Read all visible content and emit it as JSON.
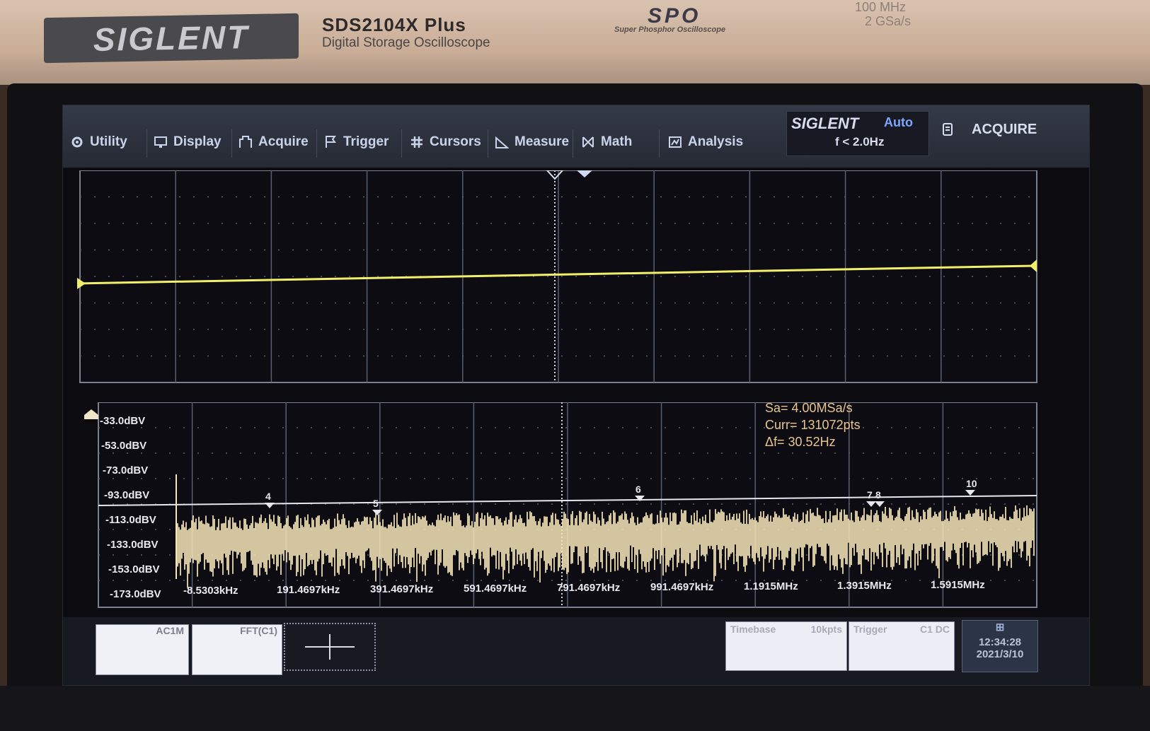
{
  "device": {
    "logo": "SIGLENT",
    "model": "SDS2104X  Plus",
    "model_sub": "Digital Storage Oscilloscope",
    "spo": "SPO",
    "spo_sub": "Super Phosphor Oscilloscope",
    "spec_bandwidth": "100 MHz",
    "spec_samplerate": "2 GSa/s"
  },
  "menu": {
    "items": [
      {
        "label": "Utility",
        "icon": "gear-icon"
      },
      {
        "label": "Display",
        "icon": "monitor-icon"
      },
      {
        "label": "Acquire",
        "icon": "acquire-icon"
      },
      {
        "label": "Trigger",
        "icon": "flag-icon"
      },
      {
        "label": "Cursors",
        "icon": "hash-icon"
      },
      {
        "label": "Measure",
        "icon": "ruler-icon"
      },
      {
        "label": "Math",
        "icon": "math-icon"
      },
      {
        "label": "Analysis",
        "icon": "analysis-icon"
      }
    ],
    "brand": "SIGLENT",
    "trigger_mode": "Auto",
    "trigger_freq": "f < 2.0Hz",
    "acquire_label": "ACQUIRE"
  },
  "fft": {
    "info_sa": "Sa=  4.00MSa/s",
    "info_curr": "Curr= 131072pts",
    "info_df": "Δf=  30.52Hz",
    "y_labels": [
      "-33.0dBV",
      "-53.0dBV",
      "-73.0dBV",
      "-93.0dBV",
      "-113.0dBV",
      "-133.0dBV",
      "-153.0dBV",
      "-173.0dBV"
    ],
    "x_labels": [
      "-8.5303kHz",
      "191.4697kHz",
      "391.4697kHz",
      "591.4697kHz",
      "791.4697kHz",
      "991.4697kHz",
      "1.1915MHz",
      "1.3915MHz",
      "1.5915MHz"
    ],
    "peak_markers": [
      "4",
      "5",
      "6",
      "7",
      "8",
      "10"
    ]
  },
  "status": {
    "ch1_tag": "AC1M",
    "fft_tag": "FFT(C1)",
    "timebase_label": "Timebase",
    "timebase_value": "10kpts",
    "trigger_label": "Trigger",
    "trigger_value": "C1 DC",
    "time": "12:34:28",
    "date": "2021/3/10"
  },
  "colors": {
    "ch1": "#f2f06a",
    "fft": "#f7e6b8",
    "grid": "#5a5f6e",
    "menu_text": "#c9d3ea",
    "accent_blue": "#7fa6ff"
  }
}
